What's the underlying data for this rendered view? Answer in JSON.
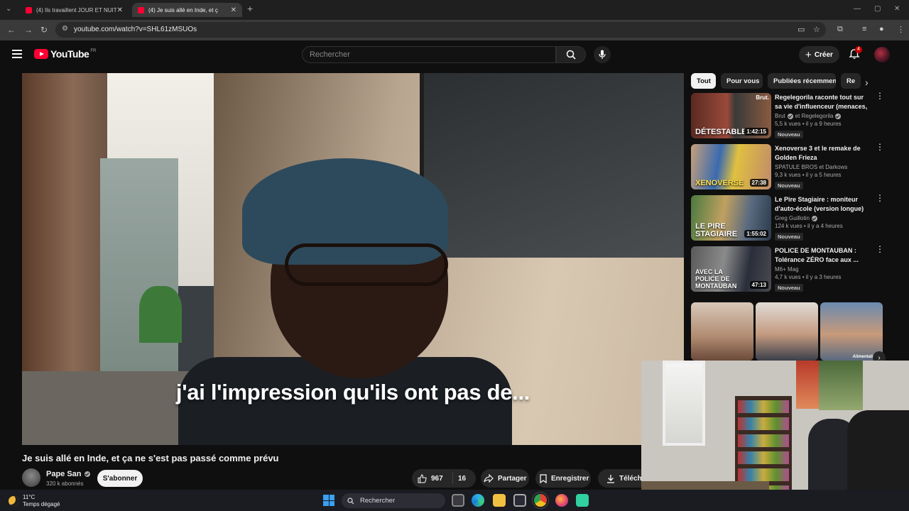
{
  "browser": {
    "tabs": [
      {
        "title": "(4) Ils travaillent JOUR ET NUIT"
      },
      {
        "title": "(4) Je suis allé en Inde, et ç"
      }
    ],
    "url": "youtube.com/watch?v=SHL61zMSUOs"
  },
  "youtube": {
    "logo_text": "YouTube",
    "region": "FR",
    "search_placeholder": "Rechercher",
    "create_label": "Créer",
    "notifications_count": "4"
  },
  "video": {
    "subtitle": "j'ai l'impression qu'ils ont pas de...",
    "title": "Je suis allé en Inde, et ça ne s'est pas passé comme prévu",
    "channel": "Pape San",
    "subscribers": "320 k abonnés",
    "subscribe_label": "S'abonner",
    "likes": "967",
    "dislikes": "16",
    "share_label": "Partager",
    "save_label": "Enregistrer",
    "download_label": "Téléchar"
  },
  "sidebar": {
    "chips": [
      "Tout",
      "Pour vous",
      "Publiées récemment",
      "Re"
    ],
    "recommendations": [
      {
        "title": "Regelegorila raconte tout sur sa vie d'influenceur (menaces, ...",
        "channel": "Brut",
        "channel_suffix": "et Regelegorila",
        "views": "5,5 k vues",
        "age": "il y a 9 heures",
        "badge": "Nouveau",
        "duration": "1:42:15",
        "thumb_text": "DÉTESTABLE",
        "thumb_corner": "Brut."
      },
      {
        "title": "Xenoverse 3 et le remake de Golden Frieza",
        "channel": "SPATULE BROS et Darkows",
        "views": "9,3 k vues",
        "age": "il y a 5 heures",
        "badge": "Nouveau",
        "duration": "27:38",
        "thumb_text": "XENOVERSE"
      },
      {
        "title": "Le Pire Stagiaire : moniteur d'auto-école (version longue)",
        "channel": "Greg Guillotin",
        "views": "124 k vues",
        "age": "il y a 4 heures",
        "badge": "Nouveau",
        "duration": "1:55:02",
        "thumb_text": "LE PIRE STAGIAIRE"
      },
      {
        "title": "POLICE DE MONTAUBAN : Tolérance ZÉRO face aux ...",
        "channel": "M6+ Mag",
        "views": "4,7 k vues",
        "age": "il y a 3 heures",
        "badge": "Nouveau",
        "duration": "47:13",
        "thumb_text": "AVEC LA POLICE DE MONTAUBAN"
      }
    ],
    "shorts_caption": "Alimentation"
  },
  "taskbar": {
    "temperature": "11°C",
    "weather": "Temps dégagé",
    "search_label": "Rechercher"
  },
  "colors": {
    "accent": "#ff0033",
    "background": "#0f0f0f",
    "chip_bg": "#272727"
  }
}
